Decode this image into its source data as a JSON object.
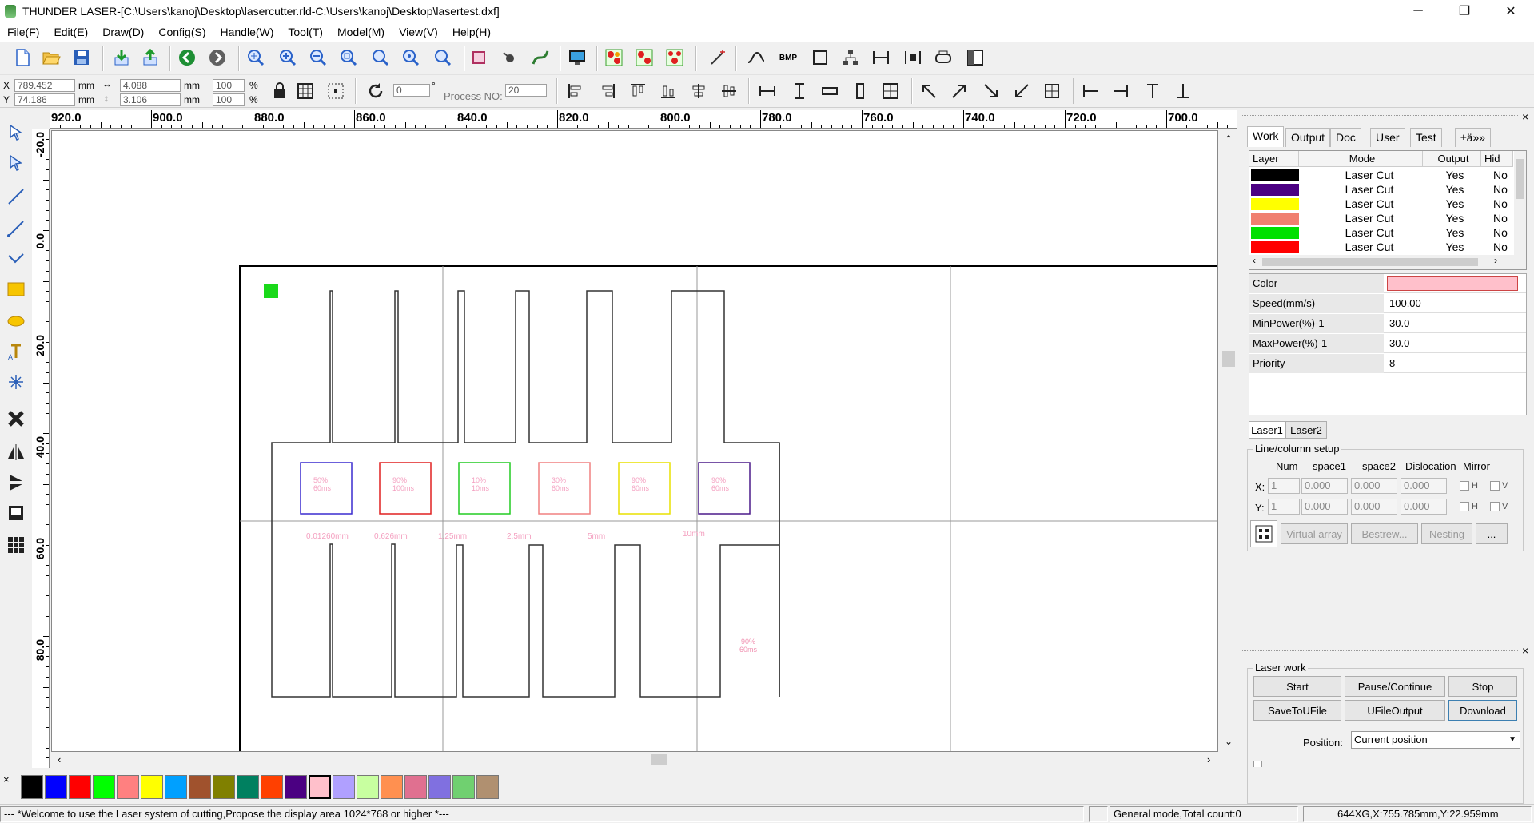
{
  "window": {
    "title": "THUNDER LASER-[C:\\Users\\kanoj\\Desktop\\lasercutter.rld-C:\\Users\\kanoj\\Desktop\\lasertest.dxf]",
    "minimize": "─",
    "restore": "❐",
    "close": "✕"
  },
  "menu": [
    "File(F)",
    "Edit(E)",
    "Draw(D)",
    "Config(S)",
    "Handle(W)",
    "Tool(T)",
    "Model(M)",
    "View(V)",
    "Help(H)"
  ],
  "coords": {
    "x_label": "X",
    "y_label": "Y",
    "x_value": "789.452",
    "y_value": "74.186",
    "unit": "mm",
    "width_value": "4.088",
    "height_value": "3.106",
    "scale_x": "100",
    "scale_y": "100",
    "percent": "%",
    "rotate_value": "0",
    "degree": "°",
    "process_no_label": "Process NO:",
    "process_no_value": "20"
  },
  "ruler": {
    "h_ticks": [
      "920.0",
      "900.0",
      "880.0",
      "860.0",
      "840.0",
      "820.0",
      "800.0",
      "780.0",
      "760.0",
      "740.0",
      "720.0",
      "700.0"
    ],
    "v_ticks": [
      "-20.0",
      "0.0",
      "20.0",
      "40.0",
      "60.0",
      "80.0"
    ]
  },
  "canvas_labels": {
    "boxes": [
      {
        "line1": "50%",
        "line2": "60ms",
        "color": "#3a2ccf"
      },
      {
        "line1": "90%",
        "line2": "100ms",
        "color": "#e02020"
      },
      {
        "line1": "10%",
        "line2": "10ms",
        "color": "#22cc22"
      },
      {
        "line1": "30%",
        "line2": "60ms",
        "color": "#f08080"
      },
      {
        "line1": "90%",
        "line2": "60ms",
        "color": "#e8e000"
      },
      {
        "line1": "90%",
        "line2": "60ms",
        "color": "#4b1a8a"
      }
    ],
    "gaps": [
      "0.01260mm",
      "0.626mm",
      "1.25mm",
      "2.5mm",
      "5mm",
      "10mm"
    ],
    "corner": {
      "line1": "90%",
      "line2": "60ms"
    }
  },
  "palette": {
    "close": "×",
    "colors": [
      "#000000",
      "#0000ff",
      "#ff0000",
      "#00ff00",
      "#ff8080",
      "#ffff00",
      "#00a0ff",
      "#a0522d",
      "#808000",
      "#008060",
      "#ff4000",
      "#4b0082",
      "#ffc0cb",
      "#b0a0ff",
      "#c8ffa0",
      "#ff9050",
      "#e07090",
      "#8070e0",
      "#70d070",
      "#b09070"
    ]
  },
  "statusbar": {
    "message": "--- *Welcome to use the Laser system of cutting,Propose the display area 1024*768 or higher *---",
    "mode": "General mode,Total count:0",
    "position": "644XG,X:755.785mm,Y:22.959mm"
  },
  "panel": {
    "tabs": [
      "Work",
      "Output",
      "Doc",
      "User",
      "Test",
      "±ä»»"
    ],
    "layer_headers": [
      "Layer",
      "Mode",
      "Output",
      "Hid"
    ],
    "layers": [
      {
        "color": "#000000",
        "mode": "Laser Cut",
        "output": "Yes",
        "hidden": "No"
      },
      {
        "color": "#4b0082",
        "mode": "Laser Cut",
        "output": "Yes",
        "hidden": "No"
      },
      {
        "color": "#ffff00",
        "mode": "Laser Cut",
        "output": "Yes",
        "hidden": "No"
      },
      {
        "color": "#f08070",
        "mode": "Laser Cut",
        "output": "Yes",
        "hidden": "No"
      },
      {
        "color": "#00e000",
        "mode": "Laser Cut",
        "output": "Yes",
        "hidden": "No"
      },
      {
        "color": "#ff0000",
        "mode": "Laser Cut",
        "output": "Yes",
        "hidden": "No"
      }
    ],
    "props": [
      {
        "key": "Color",
        "value": ""
      },
      {
        "key": "Speed(mm/s)",
        "value": "100.00"
      },
      {
        "key": "MinPower(%)-1",
        "value": "30.0"
      },
      {
        "key": "MaxPower(%)-1",
        "value": "30.0"
      },
      {
        "key": "Priority",
        "value": "8"
      }
    ],
    "color_swatch": "#ffc0cb",
    "laser_tabs": [
      "Laser1",
      "Laser2"
    ],
    "array": {
      "title": "Line/column setup",
      "headers": [
        "Num",
        "space1",
        "space2",
        "Dislocation",
        "Mirror"
      ],
      "x_label": "X:",
      "y_label": "Y:",
      "x_values": [
        "1",
        "0.000",
        "0.000",
        "0.000"
      ],
      "y_values": [
        "1",
        "0.000",
        "0.000",
        "0.000"
      ],
      "h": "H",
      "v": "V",
      "buttons": [
        "Virtual array",
        "Bestrew...",
        "Nesting",
        "..."
      ]
    },
    "laser_work": {
      "title": "Laser work",
      "start": "Start",
      "pause": "Pause/Continue",
      "stop": "Stop",
      "save": "SaveToUFile",
      "ufile": "UFileOutput",
      "download": "Download",
      "position_label": "Position:",
      "position_value": "Current position"
    }
  }
}
